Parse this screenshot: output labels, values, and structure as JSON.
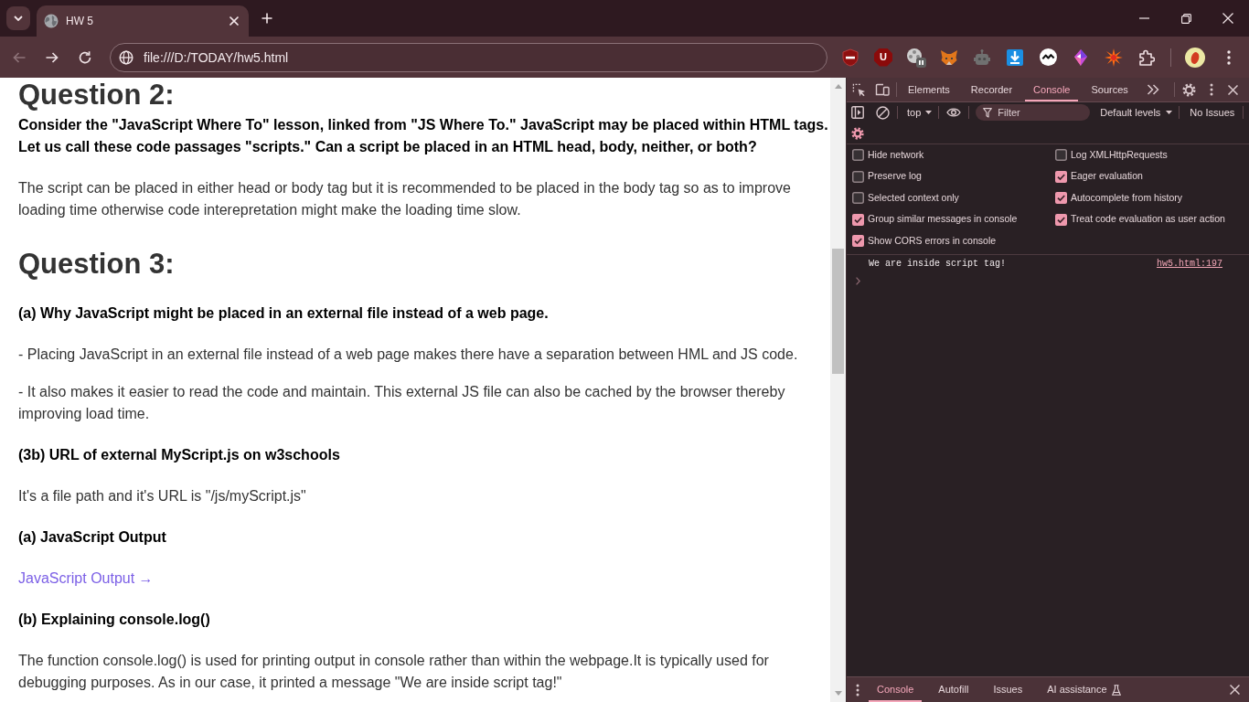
{
  "browser": {
    "tab": {
      "title": "HW 5",
      "selected": true
    },
    "nav_buttons": [
      {
        "kind": "back",
        "disabled": true
      },
      {
        "kind": "forward",
        "disabled": false
      },
      {
        "kind": "reload",
        "disabled": false
      }
    ],
    "address": "file:///D:/TODAY/hw5.html",
    "extension_letter": "U"
  },
  "page": {
    "blocks": [
      {
        "kind": "heading",
        "text": "Question 2:"
      },
      {
        "kind": "question",
        "text": "Consider the \"JavaScript Where To\" lesson, linked from \"JS Where To.\" JavaScript may be placed within HTML tags. Let us call these code passages \"scripts.\" Can a script be placed in an HTML head, body, neither, or both?"
      },
      {
        "kind": "answer",
        "text": "The script can be placed in either head or body tag but it is recommended to be placed in the body tag so as to improve loading time otherwise code interepretation might make the loading time slow."
      },
      {
        "kind": "heading",
        "text": "Question 3:"
      },
      {
        "kind": "question",
        "text": "(a) Why JavaScript might be placed in an external file instead of a web page."
      },
      {
        "kind": "answer",
        "text": "- Placing JavaScript in an external file instead of a web page makes there have a separation between HML and JS code."
      },
      {
        "kind": "answer",
        "text": "- It also makes it easier to read the code and maintain. This external JS file can also be cached by the browser thereby improving load time."
      },
      {
        "kind": "question",
        "text": "(3b) URL of external MyScript.js on w3schools"
      },
      {
        "kind": "answer",
        "text": "It's a file path and it's URL is \"/js/myScript.js\""
      },
      {
        "kind": "question",
        "text": "(a) JavaScript Output"
      },
      {
        "kind": "link",
        "text": "JavaScript Output →"
      },
      {
        "kind": "question",
        "text": "(b) Explaining console.log()"
      },
      {
        "kind": "answer",
        "text": "The function console.log() is used for printing output in console rather than within the webpage.It is typically used for debugging purposes. As in our case, it printed a message \"We are inside script tag!\""
      }
    ]
  },
  "devtools": {
    "tabs": [
      {
        "label": "Elements",
        "selected": false
      },
      {
        "label": "Recorder",
        "selected": false
      },
      {
        "label": "Console",
        "selected": true
      },
      {
        "label": "Sources",
        "selected": false
      }
    ],
    "context": "top",
    "filter_placeholder": "Filter",
    "levels": "Default levels",
    "issues": "No Issues",
    "settings_left": [
      {
        "label": "Hide network",
        "checked": false
      },
      {
        "label": "Preserve log",
        "checked": false
      },
      {
        "label": "Selected context only",
        "checked": false
      },
      {
        "label": "Group similar messages in console",
        "checked": true
      },
      {
        "label": "Show CORS errors in console",
        "checked": true
      }
    ],
    "settings_right": [
      {
        "label": "Log XMLHttpRequests",
        "checked": false
      },
      {
        "label": "Eager evaluation",
        "checked": true
      },
      {
        "label": "Autocomplete from history",
        "checked": true
      },
      {
        "label": "Treat code evaluation as user action",
        "checked": true
      }
    ],
    "messages": [
      {
        "text": "We are inside script tag!",
        "source": "hw5.html:197"
      }
    ],
    "drawer_tabs": [
      {
        "label": "Console",
        "selected": true,
        "kind": "tab"
      },
      {
        "label": "Autofill",
        "selected": false,
        "kind": "tab"
      },
      {
        "label": "Issues",
        "selected": false,
        "kind": "tab"
      },
      {
        "label": "AI assistance",
        "selected": false,
        "kind": "experimental"
      }
    ]
  }
}
